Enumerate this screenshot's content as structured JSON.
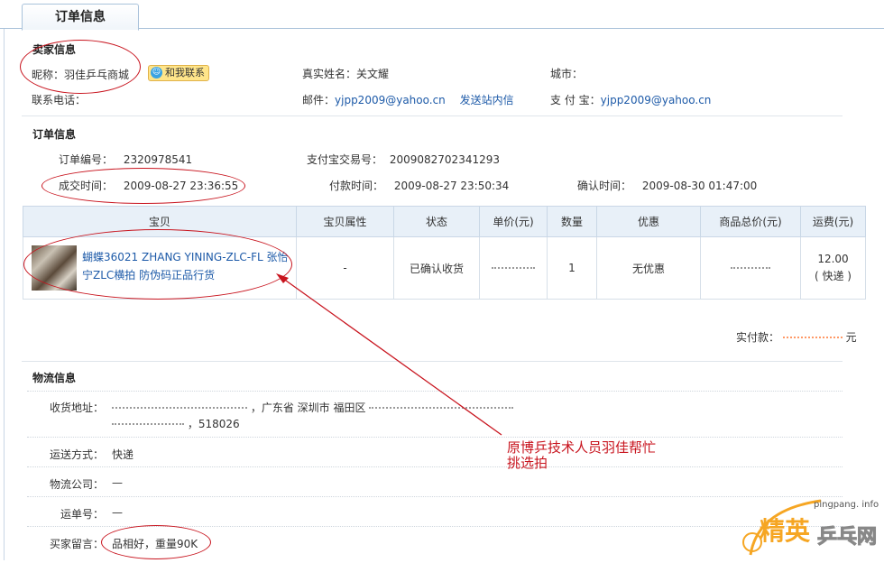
{
  "tab": {
    "label": "订单信息"
  },
  "seller": {
    "section_title": "卖家信息",
    "nickname_label": "昵称：",
    "nickname": "羽佳乒乓商城",
    "contact_label": "和我联系",
    "realname_label": "真实姓名：",
    "realname": "关文耀",
    "city_label": "城市：",
    "city": "",
    "phone_label": "联系电话：",
    "phone": "",
    "email_label": "邮件：",
    "email": "yjpp2009@yahoo.cn",
    "send_msg_label": "发送站内信",
    "alipay_label": "支 付 宝：",
    "alipay": "yjpp2009@yahoo.cn"
  },
  "order": {
    "section_title": "订单信息",
    "order_no_label": "订单编号：",
    "order_no": "2320978541",
    "trade_no_label": "支付宝交易号：",
    "trade_no": "2009082702341293",
    "deal_time_label": "成交时间：",
    "deal_time": "2009-08-27 23:36:55",
    "pay_time_label": "付款时间：",
    "pay_time": "2009-08-27 23:50:34",
    "confirm_time_label": "确认时间：",
    "confirm_time": "2009-08-30 01:47:00"
  },
  "items_table": {
    "headers": [
      "宝贝",
      "宝贝属性",
      "状态",
      "单价(元)",
      "数量",
      "优惠",
      "商品总价(元)",
      "运费(元)"
    ],
    "rows": [
      {
        "title": "蝴蝶36021 ZHANG YINING-ZLC-FL 张怡宁ZLC横拍 防伪码正品行货",
        "attr": "-",
        "status": "已确认收货",
        "unit_price": "",
        "quantity": "1",
        "discount": "无优惠",
        "total": "",
        "shipping": "12.00",
        "shipping_method": "( 快递 )"
      }
    ]
  },
  "payment": {
    "label": "实付款：",
    "amount": "",
    "unit": "元"
  },
  "logistics": {
    "section_title": "物流信息",
    "address_label": "收货地址：",
    "address_line1": "，广东省 深圳市 福田区",
    "address_line2": "，518026",
    "method_label": "运送方式：",
    "method": "快递",
    "company_label": "物流公司：",
    "company": "—",
    "waybill_label": "运单号：",
    "waybill": "—",
    "message_label": "买家留言：",
    "message": "品相好，重量90K"
  },
  "annotation": {
    "line1": "原博乒技术人员羽佳帮忙",
    "line2": "挑选拍"
  },
  "watermark": {
    "site": "pingpang. info",
    "brand_a": "精英",
    "brand_b": "乒乓网"
  },
  "colors": {
    "link": "#1d5aa8",
    "annotation": "#c8141e",
    "price": "#ff5500",
    "header_bg": "#e8f0f8"
  }
}
